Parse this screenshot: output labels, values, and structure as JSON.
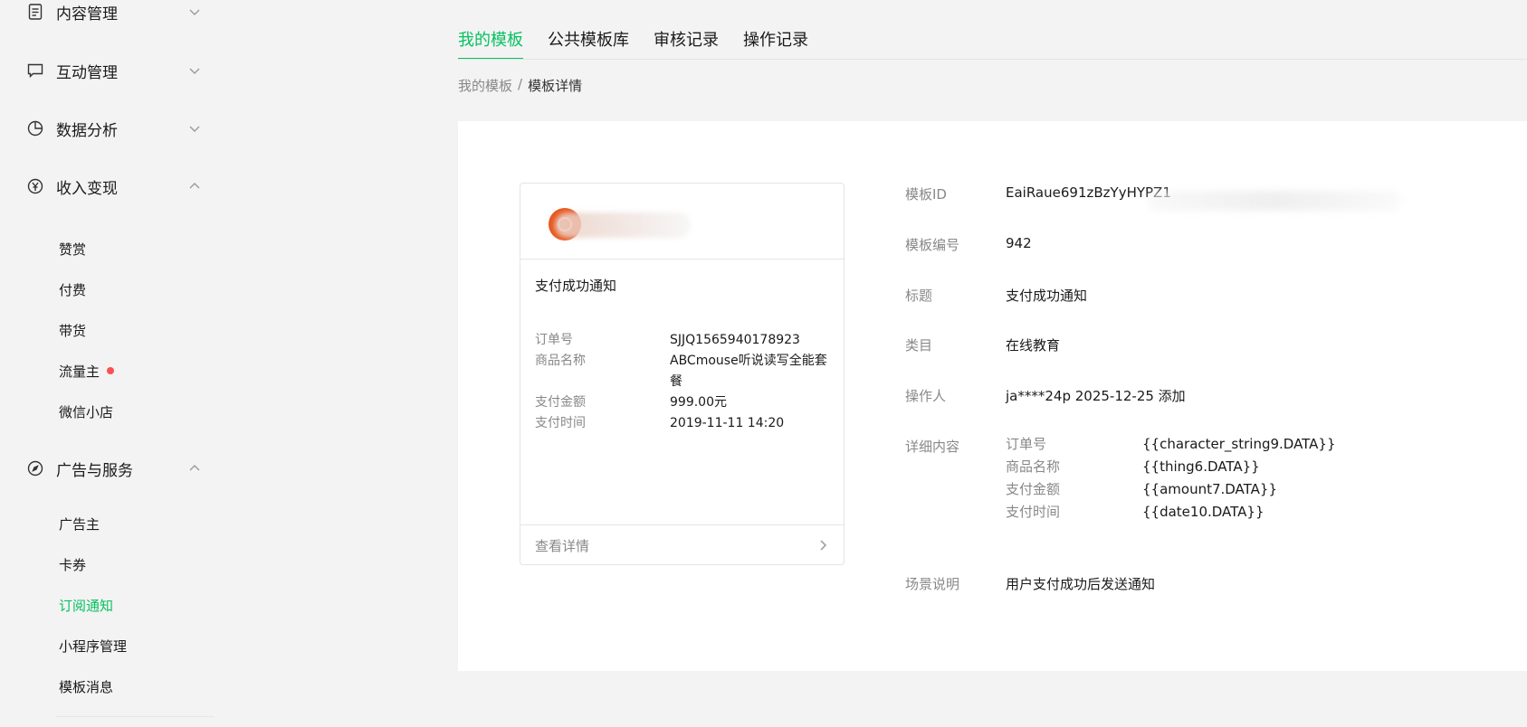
{
  "sidebar": {
    "groups": [
      {
        "label": "内容管理",
        "icon": "document-icon",
        "expanded": false
      },
      {
        "label": "互动管理",
        "icon": "chat-bubble-icon",
        "expanded": false
      },
      {
        "label": "数据分析",
        "icon": "pie-chart-icon",
        "expanded": false
      },
      {
        "label": "收入变现",
        "icon": "yen-coin-icon",
        "expanded": true
      },
      {
        "label": "广告与服务",
        "icon": "compass-icon",
        "expanded": true
      }
    ],
    "income_items": [
      "赞赏",
      "付费",
      "带货",
      "流量主",
      "微信小店"
    ],
    "ads_items": [
      "广告主",
      "卡券",
      "订阅通知",
      "小程序管理",
      "模板消息"
    ],
    "active_item": "订阅通知"
  },
  "tabs": [
    "我的模板",
    "公共模板库",
    "审核记录",
    "操作记录"
  ],
  "active_tab": "我的模板",
  "breadcrumb": {
    "parent": "我的模板",
    "separator": "/",
    "current": "模板详情"
  },
  "preview_card": {
    "title": "支付成功通知",
    "fields": [
      {
        "key": "订单号",
        "value": "SJJQ1565940178923"
      },
      {
        "key": "商品名称",
        "value": "ABCmouse听说读写全能套餐"
      },
      {
        "key": "支付金额",
        "value": "999.00元"
      },
      {
        "key": "支付时间",
        "value": "2019-11-11 14:20"
      }
    ],
    "footer_link": "查看详情"
  },
  "details": {
    "template_id": {
      "key": "模板ID",
      "value": "EaiRaue691zBzYyHYPZ1"
    },
    "template_no": {
      "key": "模板编号",
      "value": "942"
    },
    "title": {
      "key": "标题",
      "value": "支付成功通知"
    },
    "category": {
      "key": "类目",
      "value": "在线教育"
    },
    "operator": {
      "key": "操作人",
      "value": "ja****24p 2025-12-25 添加"
    },
    "content": {
      "key": "详细内容",
      "rows": [
        {
          "key": "订单号",
          "value": "{{character_string9.DATA}}"
        },
        {
          "key": "商品名称",
          "value": "{{thing6.DATA}}"
        },
        {
          "key": "支付金额",
          "value": "{{amount7.DATA}}"
        },
        {
          "key": "支付时间",
          "value": "{{date10.DATA}}"
        }
      ]
    },
    "scene": {
      "key": "场景说明",
      "value": "用户支付成功后发送通知"
    }
  },
  "colors": {
    "accent": "#07c160",
    "alert_dot": "#fa5151",
    "avatar": "#e8571e"
  }
}
